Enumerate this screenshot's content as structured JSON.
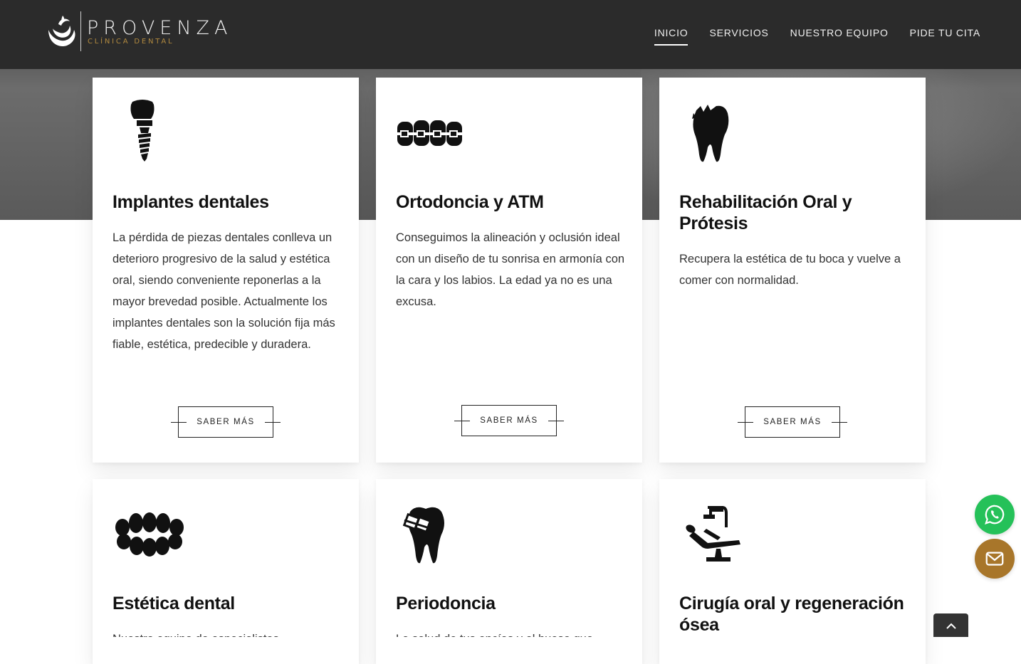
{
  "brand": {
    "name": "PROVENZA",
    "subtitle": "CLÍNICA DENTAL"
  },
  "nav": {
    "items": [
      {
        "label": "INICIO",
        "active": true
      },
      {
        "label": "SERVICIOS",
        "active": false
      },
      {
        "label": "NUESTRO EQUIPO",
        "active": false
      },
      {
        "label": "PIDE TU CITA",
        "active": false
      }
    ]
  },
  "services": [
    {
      "icon": "dental-implant-icon",
      "title": "Implantes dentales",
      "description": "La pérdida de piezas dentales conlleva un deterioro progresivo de la salud y estética oral, siendo conveniente reponerlas a la mayor brevedad posible. Actualmente los implantes dentales son la solución fija más fiable, estética, predecible y duradera.",
      "button": "SABER MÁS"
    },
    {
      "icon": "braces-icon",
      "title": "Ortodoncia y ATM",
      "description": "Conseguimos la alineación y oclusión ideal con un diseño de tu sonrisa en armonía con la cara y los labios. La edad ya no es una excusa.",
      "button": "SABER MÁS"
    },
    {
      "icon": "broken-tooth-icon",
      "title": "Rehabilitación Oral y Prótesis",
      "description": "Recupera la estética de tu boca y vuelve a comer con normalidad.",
      "button": "SABER MÁS"
    },
    {
      "icon": "teeth-row-icon",
      "title": "Estética dental",
      "description": "Nuestro equipo de especialistas"
    },
    {
      "icon": "tooth-bracket-icon",
      "title": "Periodoncia",
      "description": "La salud de tus encías y el hueso que"
    },
    {
      "icon": "dental-chair-icon",
      "title": "Cirugía oral y regeneración ósea",
      "description": ""
    }
  ],
  "floating": {
    "whatsapp_color": "#25c159",
    "email_color": "#a8762a"
  }
}
